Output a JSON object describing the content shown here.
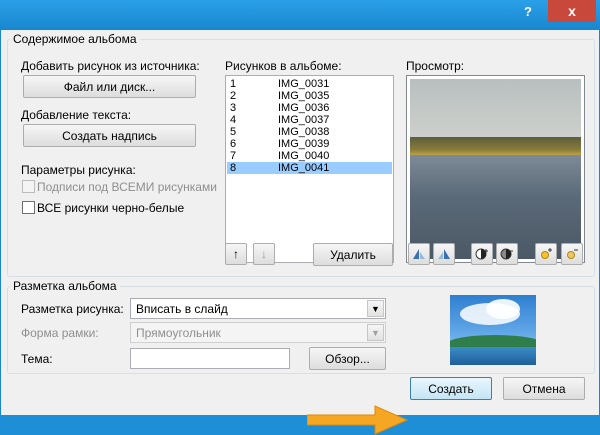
{
  "titlebar": {
    "help_label": "?",
    "close_label": "x"
  },
  "album_content": {
    "group_label": "Содержимое альбома",
    "insert_from_label": "Добавить рисунок из источника:",
    "file_button_label": "Файл или диск...",
    "add_text_label": "Добавление текста:",
    "new_textbox_button_label": "Создать надпись",
    "picture_options_label": "Параметры рисунка:",
    "captions_checkbox_label": "Подписи под ВСЕМИ рисунками",
    "bw_checkbox_label": "ВСЕ рисунки черно-белые",
    "pictures_label": "Рисунков в альбоме:",
    "pictures": [
      {
        "num": "1",
        "name": "IMG_0031"
      },
      {
        "num": "2",
        "name": "IMG_0035"
      },
      {
        "num": "3",
        "name": "IMG_0036"
      },
      {
        "num": "4",
        "name": "IMG_0037"
      },
      {
        "num": "5",
        "name": "IMG_0038"
      },
      {
        "num": "6",
        "name": "IMG_0039"
      },
      {
        "num": "7",
        "name": "IMG_0040"
      },
      {
        "num": "8",
        "name": "IMG_0041"
      }
    ],
    "selected_index": 7,
    "move_up_icon": "↑",
    "move_down_icon": "↓",
    "remove_button_label": "Удалить",
    "preview_label": "Просмотр:"
  },
  "album_layout": {
    "group_label": "Разметка альбома",
    "picture_layout_label": "Разметка рисунка:",
    "picture_layout_value": "Вписать в слайд",
    "frame_shape_label": "Форма рамки:",
    "frame_shape_value": "Прямоугольник",
    "theme_label": "Тема:",
    "theme_value": "",
    "browse_button_label": "Обзор..."
  },
  "footer": {
    "create_button_label": "Создать",
    "cancel_button_label": "Отмена"
  },
  "colors": {
    "titlebar": "#1887cf",
    "close_button": "#c9483c",
    "selection": "#99ccff",
    "annotation_arrow": "#f5a623"
  }
}
